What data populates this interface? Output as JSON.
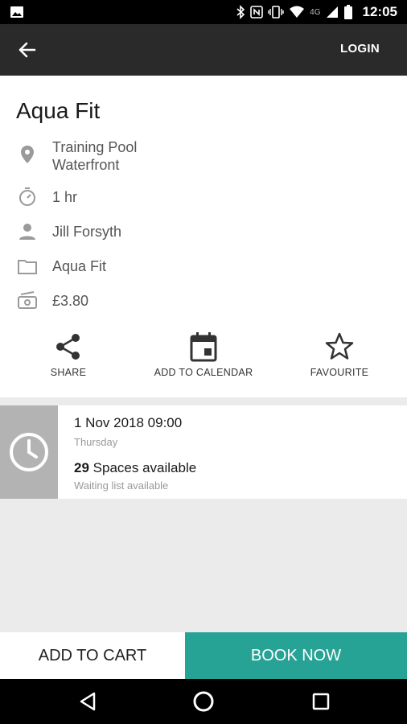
{
  "status_bar": {
    "time": "12:05",
    "network": "4G",
    "icons": [
      "image-icon",
      "bluetooth-icon",
      "nfc-icon",
      "vibrate-icon",
      "wifi-icon",
      "signal-icon",
      "battery-icon"
    ]
  },
  "app_bar": {
    "back_icon": "arrow-back-icon",
    "login_label": "LOGIN"
  },
  "class": {
    "title": "Aqua Fit",
    "location_line1": "Training Pool",
    "location_line2": "Waterfront",
    "duration": "1 hr",
    "instructor": "Jill Forsyth",
    "category": "Aqua Fit",
    "price": "£3.80"
  },
  "actions": {
    "share": "SHARE",
    "calendar": "ADD TO CALENDAR",
    "favourite": "FAVOURITE"
  },
  "session": {
    "date": "1 Nov 2018 09:00",
    "day": "Thursday",
    "spaces_count": "29",
    "spaces_label": " Spaces available",
    "waiting": "Waiting list available"
  },
  "bottom": {
    "cart_label": "ADD TO CART",
    "book_label": "BOOK NOW"
  },
  "colors": {
    "accent": "#27a396",
    "app_bar": "#2a2a2a",
    "clock_box": "#b3b3b3"
  }
}
